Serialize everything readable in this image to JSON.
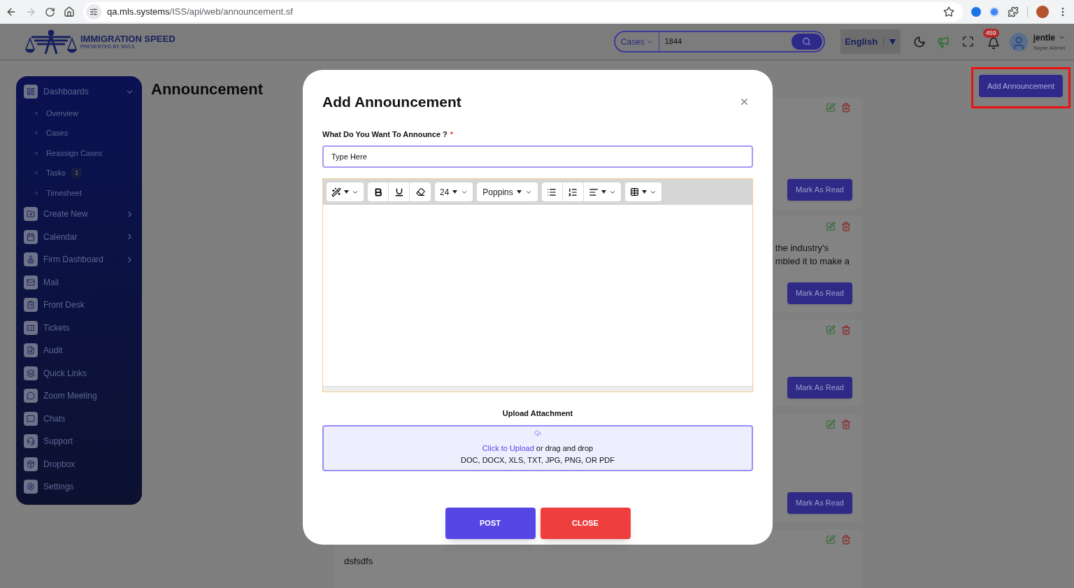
{
  "browser": {
    "url_host": "qa.mls.systems",
    "url_path": "/ISS/api/web/announcement.sf",
    "forward_disabled": true
  },
  "header": {
    "brand_name": "IMMIGRATION SPEED",
    "brand_tagline": "PRESENTED BY MVLS",
    "search": {
      "scope": "Cases",
      "value": "1844"
    },
    "language": "English",
    "notifications": "459",
    "user": {
      "name": "jentle",
      "role": "Super Admin"
    }
  },
  "sidebar": {
    "items": [
      {
        "label": "Dashboards",
        "kind": "group",
        "expanded": true,
        "children": [
          {
            "label": "Overview"
          },
          {
            "label": "Cases"
          },
          {
            "label": "Reassign Cases"
          },
          {
            "label": "Tasks",
            "badge": "1"
          },
          {
            "label": "Timesheet"
          }
        ]
      },
      {
        "label": "Create New",
        "kind": "group",
        "expanded": false
      },
      {
        "label": "Calendar",
        "kind": "group",
        "expanded": false
      },
      {
        "label": "Firm Dashboard",
        "kind": "group",
        "expanded": false
      },
      {
        "label": "Mail",
        "kind": "link"
      },
      {
        "label": "Front Desk",
        "kind": "link"
      },
      {
        "label": "Tickets",
        "kind": "link"
      },
      {
        "label": "Audit",
        "kind": "link"
      },
      {
        "label": "Quick Links",
        "kind": "link"
      },
      {
        "label": "Zoom Meeting",
        "kind": "link"
      },
      {
        "label": "Chats",
        "kind": "link"
      },
      {
        "label": "Support",
        "kind": "link"
      },
      {
        "label": "Dropbox",
        "kind": "link"
      },
      {
        "label": "Settings",
        "kind": "link"
      }
    ]
  },
  "page": {
    "title": "Announcement",
    "add_button": "Add Announcement",
    "highlighted": true,
    "announcements": [
      {
        "button": "Mark As Read"
      },
      {
        "lines": [
          "the industry's",
          "mbled it to make a"
        ],
        "button": "Mark As Read"
      },
      {
        "button": "Mark As Read"
      },
      {
        "button": "Mark As Read"
      },
      {
        "lines": [
          "dsfsdfs"
        ]
      }
    ]
  },
  "modal": {
    "title": "Add Announcement",
    "question_label": "What Do You Want To Announce ?",
    "required_mark": "*",
    "input": {
      "placeholder": "Type Here"
    },
    "toolbar": {
      "font_size": "24",
      "font_family": "Poppins"
    },
    "upload": {
      "label": "Upload Attachment",
      "link": "Click to Upload",
      "text": "or drag and drop",
      "formats": "DOC, DOCX, XLS, TXT, JPG, PNG, OR PDF"
    },
    "buttons": {
      "post": "POST",
      "close": "CLOSE"
    }
  }
}
